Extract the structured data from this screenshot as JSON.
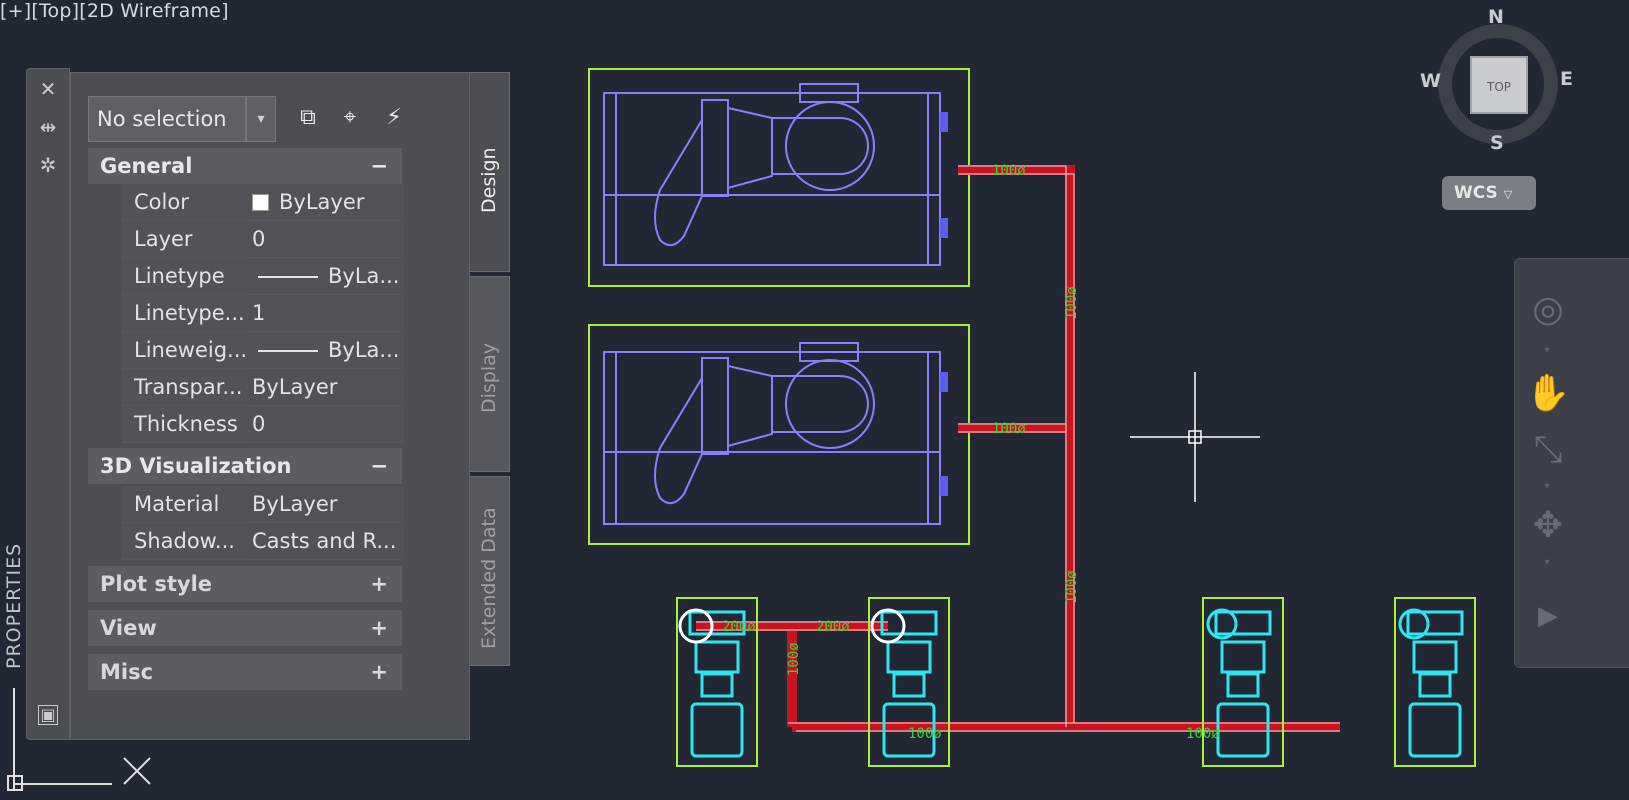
{
  "viewport": {
    "label": "[+][Top][2D Wireframe]"
  },
  "properties": {
    "vertical_title": "PROPERTIES",
    "selection": "No selection",
    "tabs": [
      "Design",
      "Display",
      "Extended Data"
    ],
    "general": {
      "title": "General",
      "toggle": "−",
      "rows": [
        {
          "name": "Color",
          "value": "ByLayer"
        },
        {
          "name": "Layer",
          "value": "0"
        },
        {
          "name": "Linetype",
          "value": "ByLa..."
        },
        {
          "name": "Linetype...",
          "value": "1"
        },
        {
          "name": "Lineweig...",
          "value": "ByLa..."
        },
        {
          "name": "Transpar...",
          "value": "ByLayer"
        },
        {
          "name": "Thickness",
          "value": "0"
        }
      ]
    },
    "visualization": {
      "title": "3D Visualization",
      "toggle": "−",
      "rows": [
        {
          "name": "Material",
          "value": "ByLayer"
        },
        {
          "name": "Shadow...",
          "value": "Casts and R..."
        }
      ]
    },
    "collapsed_sections": [
      {
        "title": "Plot style",
        "toggle": "+"
      },
      {
        "title": "View",
        "toggle": "+"
      },
      {
        "title": "Misc",
        "toggle": "+"
      }
    ]
  },
  "viewcube": {
    "top": "TOP",
    "north": "N",
    "south": "S",
    "east": "E",
    "west": "W",
    "ucs": "WCS"
  },
  "drawing": {
    "pipe_labels": [
      "100ø",
      "100ø",
      "100ø",
      "100ø",
      "200ø",
      "200ø",
      "100ø",
      "100ø",
      "100ø"
    ]
  },
  "colors": {
    "background": "#212834",
    "equipment_outline": "#8a7dff",
    "bounding_box": "#a8f03c",
    "pipe_red": "#c8141e",
    "pump_cyan": "#2ee6f0",
    "label_green": "#3cd23c"
  }
}
